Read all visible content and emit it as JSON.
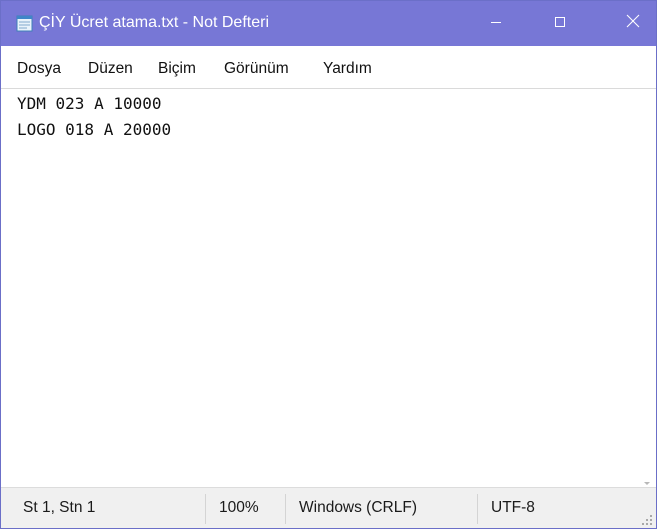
{
  "window": {
    "title": "ÇİY Ücret atama.txt - Not Defteri",
    "icon": "notepad-icon",
    "title_bar_color": "#7777d6"
  },
  "controls": {
    "minimize_icon": "minimize-icon",
    "maximize_icon": "maximize-icon",
    "close_icon": "close-icon"
  },
  "menu": {
    "items": [
      "Dosya",
      "Düzen",
      "Biçim",
      "Görünüm",
      "Yardım"
    ]
  },
  "editor": {
    "lines": [
      "YDM 023 A 10000",
      "LOGO 018 A 20000"
    ]
  },
  "status": {
    "position": "St 1, Stn 1",
    "zoom": "100%",
    "line_ending": "Windows (CRLF)",
    "encoding": "UTF-8"
  }
}
